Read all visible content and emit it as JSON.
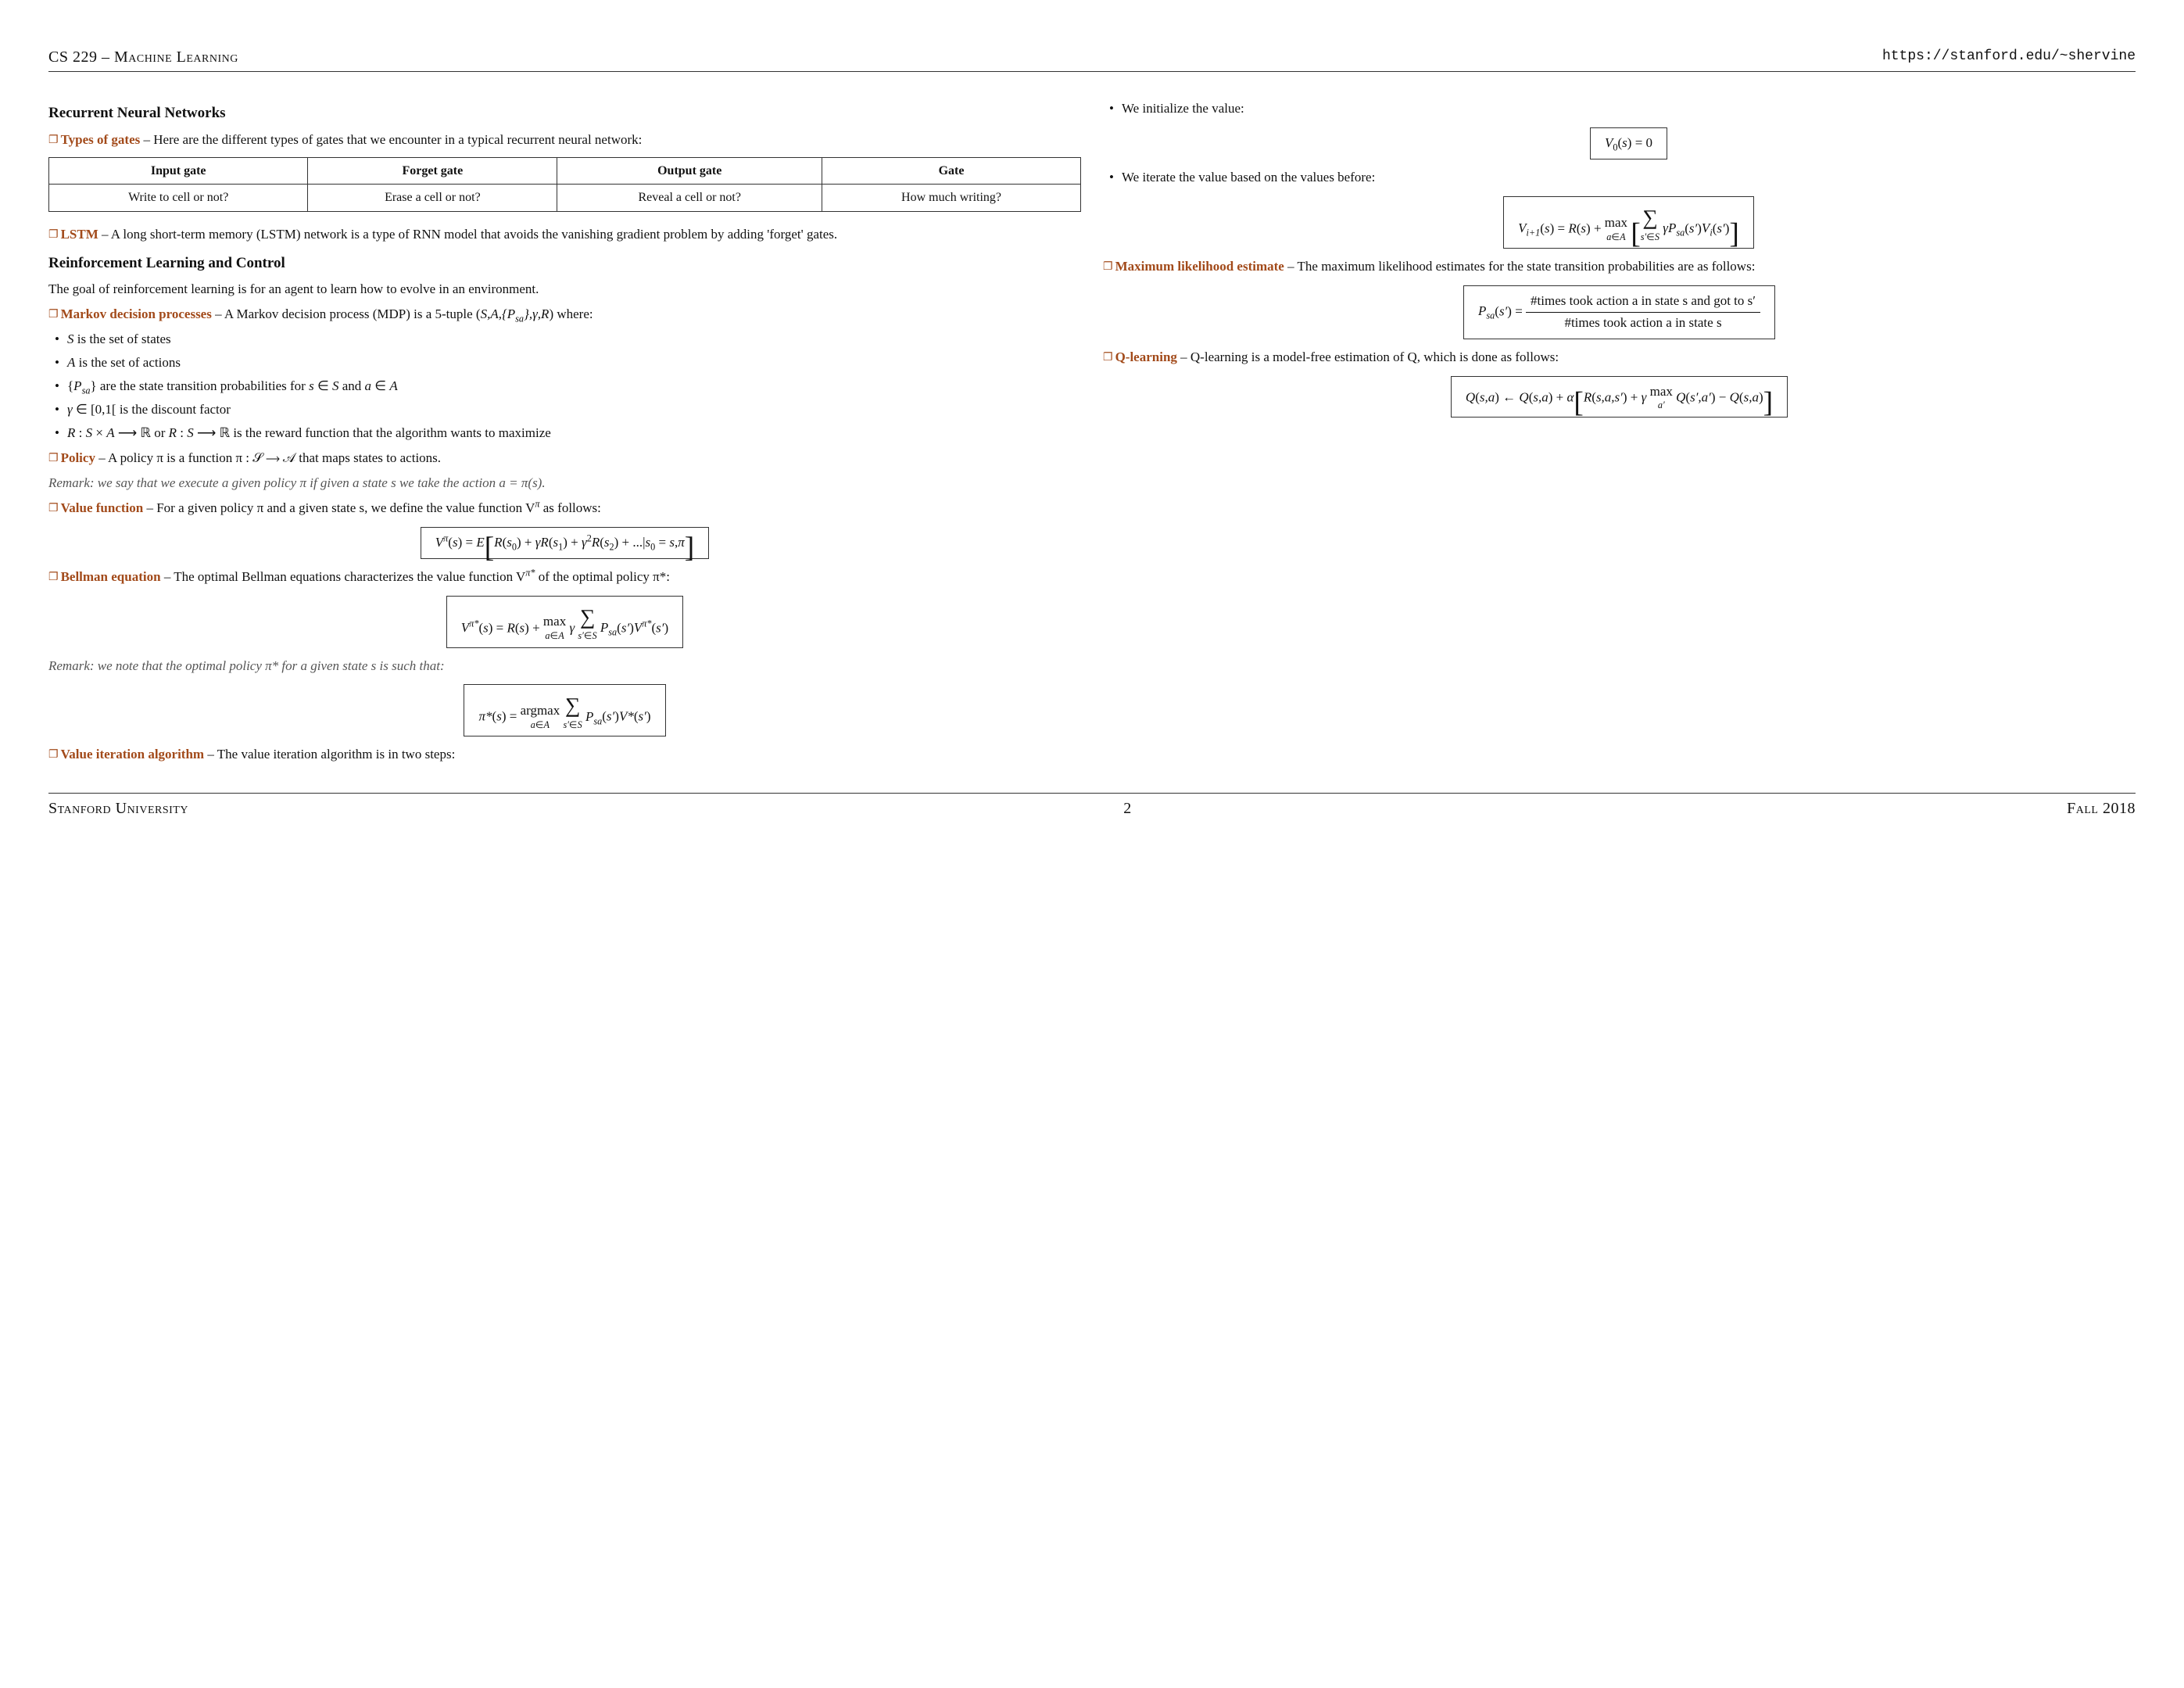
{
  "header": {
    "left": "CS 229 – Machine Learning",
    "right": "https://stanford.edu/~shervine"
  },
  "footer": {
    "left": "Stanford University",
    "page": "2",
    "right": "Fall 2018"
  },
  "left": {
    "rnn_heading": "Recurrent Neural Networks",
    "types_head": "Types of gates",
    "types_body": " – Here are the different types of gates that we encounter in a typical recurrent neural network:",
    "gates_table": {
      "h1": "Input gate",
      "h2": "Forget gate",
      "h3": "Output gate",
      "h4": "Gate",
      "c1": "Write to cell or not?",
      "c2": "Erase a cell or not?",
      "c3": "Reveal a cell or not?",
      "c4": "How much writing?"
    },
    "lstm_head": "LSTM",
    "lstm_body": " – A long short-term memory (LSTM) network is a type of RNN model that avoids the vanishing gradient problem by adding 'forget' gates.",
    "rl_heading": "Reinforcement Learning and Control",
    "rl_intro": "The goal of reinforcement learning is for an agent to learn how to evolve in an environment.",
    "mdp_head": "Markov decision processes",
    "mdp_body_a": " – A Markov decision process (MDP) is a 5-tuple (",
    "mdp_body_b": ") where:",
    "mdp_items": {
      "b1a": " is the set of states",
      "b2a": " is the set of actions",
      "b3a": "} are the state transition probabilities for ",
      "b4a": " ∈ [0,1[ is the discount factor",
      "b5a": " is the reward function that the algorithm wants to maximize"
    },
    "policy_head": "Policy",
    "policy_body": " – A policy π is a function π : 𝒮 ⟶ 𝒜 that maps states to actions.",
    "policy_remark_a": "Remark: we say that we execute a given policy π if given a state s we take the action a = π(s).",
    "value_head": "Value function",
    "value_body_a": " – For a given policy π and a given state s, we define the value function V",
    "value_body_b": " as follows:",
    "value_eq": "V π(s) = E[ R(s₀) + γR(s₁) + γ²R(s₂) + ... | s₀ = s, π ]",
    "bellman_head": "Bellman equation",
    "bellman_body_a": " – The optimal Bellman equations characterizes the value function V",
    "bellman_body_b": " of the optimal policy π*:",
    "bellman_remark": "Remark: we note that the optimal policy π* for a given state s is such that:",
    "valiter_head": "Value iteration algorithm",
    "valiter_body": " – The value iteration algorithm is in two steps:"
  },
  "right": {
    "init_text": "We initialize the value:",
    "init_eq": "V₀(s) = 0",
    "iter_text": "We iterate the value based on the values before:",
    "mle_head": "Maximum likelihood estimate",
    "mle_body": " – The maximum likelihood estimates for the state transition probabilities are as follows:",
    "mle_num": "#times took action a in state s and got to s′",
    "mle_den": "#times took action a in state s",
    "ql_head": "Q-learning",
    "ql_body": " – Q-learning is a model-free estimation of Q, which is done as follows:"
  }
}
